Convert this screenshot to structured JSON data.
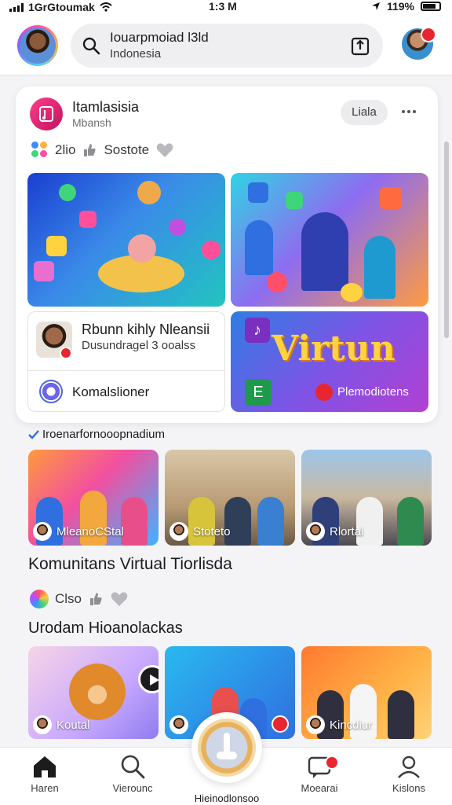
{
  "status_bar": {
    "carrier": "1GrGtoumak",
    "time": "1:3 M",
    "battery": "119%"
  },
  "header": {
    "search_title": "Iouarpmoiad l3ld",
    "search_subtitle": "Indonesia"
  },
  "post": {
    "group_name": "Itamlasisia",
    "group_sub": "Mbansh",
    "join_label": "Liala",
    "meta_count": "2lio",
    "meta_label": "Sostote",
    "info_title": "Rbunn kihly Nleansii",
    "info_subtitle": "Dusundragel 3 ooalss",
    "info_link": "Komalslioner",
    "banner_text": "Virtun",
    "banner_label": "Plemodiotens"
  },
  "section_one": {
    "tag": "Iroenarfornooopnadium",
    "thumbs": [
      {
        "label": "MleanoCStal"
      },
      {
        "label": "Stoteto"
      },
      {
        "label": "Rlortal"
      }
    ],
    "title": "Komunitans Virtual Tiorlisda",
    "meta_count": "Clso"
  },
  "section_two": {
    "title": "Urodam Hioanolackas",
    "thumbs": [
      {
        "label": "Koutal"
      },
      {
        "label": ""
      },
      {
        "label": "Kincdiur"
      }
    ]
  },
  "bottom_nav": {
    "home": "Haren",
    "view": "Vierounc",
    "fab": "Hieinodlonsoo",
    "messages": "Moearai",
    "profile": "Kislons"
  },
  "colors": {
    "accent": "#e8262f",
    "brand_pink": "#ff3d8b"
  }
}
